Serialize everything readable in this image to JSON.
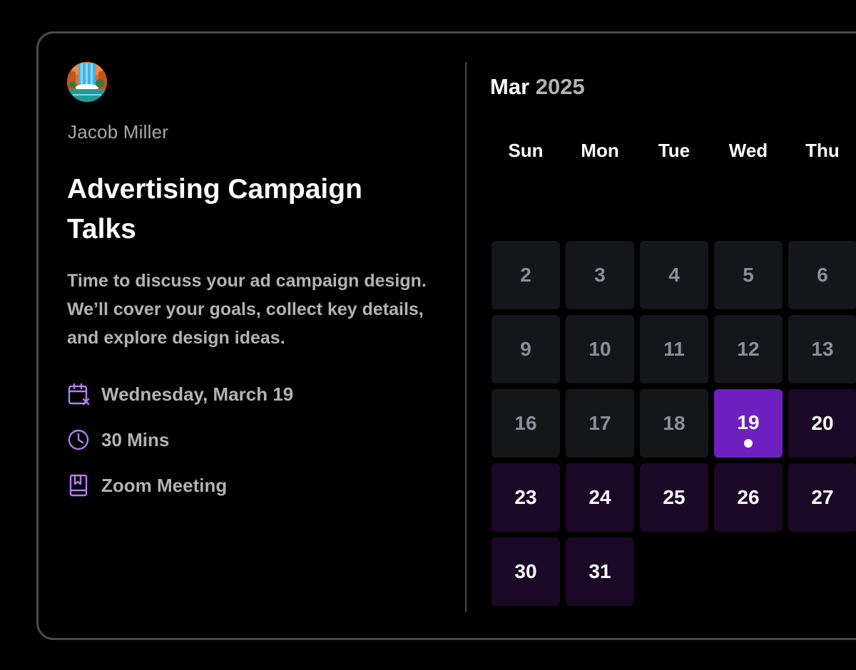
{
  "host": {
    "name": "Jacob Miller",
    "avatar_icon": "waterfall-avatar"
  },
  "event": {
    "title": "Advertising Campaign Talks",
    "description": "Time to discuss your ad campaign design. We’ll cover your goals, collect key details, and explore design ideas.",
    "details": [
      {
        "icon": "calendar-x-icon",
        "text": "Wednesday, March 19"
      },
      {
        "icon": "clock-icon",
        "text": "30 Mins"
      },
      {
        "icon": "bookmark-book-icon",
        "text": "Zoom Meeting"
      }
    ]
  },
  "calendar": {
    "month": "Mar",
    "year": "2025",
    "weekdays": [
      "Sun",
      "Mon",
      "Tue",
      "Wed",
      "Thu"
    ],
    "weeks": [
      [
        {
          "day": "2",
          "state": "past"
        },
        {
          "day": "3",
          "state": "past"
        },
        {
          "day": "4",
          "state": "past"
        },
        {
          "day": "5",
          "state": "past"
        },
        {
          "day": "6",
          "state": "past"
        }
      ],
      [
        {
          "day": "9",
          "state": "past"
        },
        {
          "day": "10",
          "state": "past"
        },
        {
          "day": "11",
          "state": "past"
        },
        {
          "day": "12",
          "state": "past"
        },
        {
          "day": "13",
          "state": "past"
        }
      ],
      [
        {
          "day": "16",
          "state": "past"
        },
        {
          "day": "17",
          "state": "past"
        },
        {
          "day": "18",
          "state": "past"
        },
        {
          "day": "19",
          "state": "selected"
        },
        {
          "day": "20",
          "state": "available"
        }
      ],
      [
        {
          "day": "23",
          "state": "available"
        },
        {
          "day": "24",
          "state": "available"
        },
        {
          "day": "25",
          "state": "available"
        },
        {
          "day": "26",
          "state": "available"
        },
        {
          "day": "27",
          "state": "available"
        }
      ],
      [
        {
          "day": "30",
          "state": "available"
        },
        {
          "day": "31",
          "state": "available"
        }
      ]
    ]
  },
  "colors": {
    "accent": "#6e1fbf",
    "icon_accent": "#b57cf0",
    "available_bg": "#1a0826",
    "past_bg": "#15161a",
    "border": "#4a4a4a"
  }
}
